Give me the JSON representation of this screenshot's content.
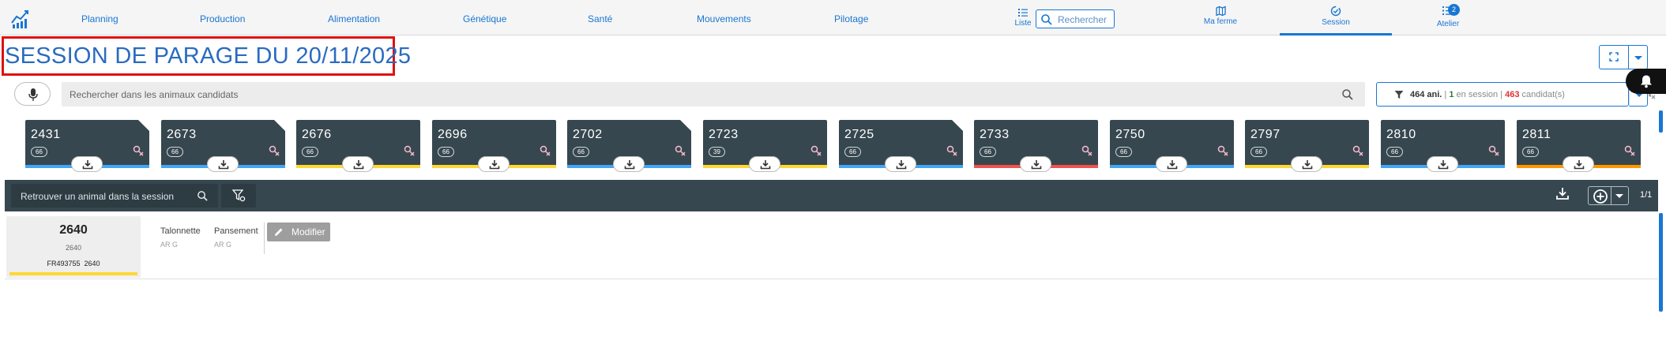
{
  "nav": {
    "items": [
      "Planning",
      "Production",
      "Alimentation",
      "Génétique",
      "Santé",
      "Mouvements",
      "Pilotage"
    ],
    "liste_label": "Liste",
    "search_placeholder": "Rechercher",
    "tabs": [
      {
        "label": "Ma ferme",
        "icon": "map-icon"
      },
      {
        "label": "Session",
        "icon": "session-check-icon",
        "active": true
      },
      {
        "label": "Atelier",
        "icon": "list-icon",
        "badge": "2"
      }
    ]
  },
  "page": {
    "title": "SESSION DE PARAGE DU 20/11/2025"
  },
  "candidates": {
    "search_placeholder": "Rechercher dans les animaux candidats",
    "filter": {
      "animals_count": "464 ani.",
      "in_session_count": "1",
      "in_session_label": "en session",
      "candidates_count": "463",
      "candidates_label": "candidat(s)"
    },
    "cards": [
      {
        "number": "2431",
        "pill": "66",
        "color": "#42a5f5",
        "folded": true
      },
      {
        "number": "2673",
        "pill": "66",
        "color": "#42a5f5",
        "folded": true
      },
      {
        "number": "2676",
        "pill": "66",
        "color": "#fdd835",
        "folded": false
      },
      {
        "number": "2696",
        "pill": "66",
        "color": "#fdd835",
        "folded": false
      },
      {
        "number": "2702",
        "pill": "66",
        "color": "#42a5f5",
        "folded": true
      },
      {
        "number": "2723",
        "pill": "39",
        "color": "#fdd835",
        "folded": false
      },
      {
        "number": "2725",
        "pill": "66",
        "color": "#42a5f5",
        "folded": true
      },
      {
        "number": "2733",
        "pill": "66",
        "color": "#ef5350",
        "folded": false
      },
      {
        "number": "2750",
        "pill": "66",
        "color": "#42a5f5",
        "folded": false
      },
      {
        "number": "2797",
        "pill": "66",
        "color": "#fdd835",
        "folded": false
      },
      {
        "number": "2810",
        "pill": "66",
        "color": "#42a5f5",
        "folded": false
      },
      {
        "number": "2811",
        "pill": "66",
        "color": "#ff9800",
        "folded": false
      }
    ]
  },
  "session": {
    "search_placeholder": "Retrouver un animal dans la session",
    "pagination": "1/1",
    "animal": {
      "number": "2640",
      "sub": "2640",
      "national_id": "FR493755  2640",
      "fields": [
        {
          "label": "Talonnette",
          "value": "AR G"
        },
        {
          "label": "Pansement",
          "value": "AR G"
        }
      ],
      "modify_label": "Modifier"
    }
  },
  "colors": {
    "primary": "#1976d2",
    "dark_panel": "#37474f",
    "title_highlight": "#e01010"
  }
}
